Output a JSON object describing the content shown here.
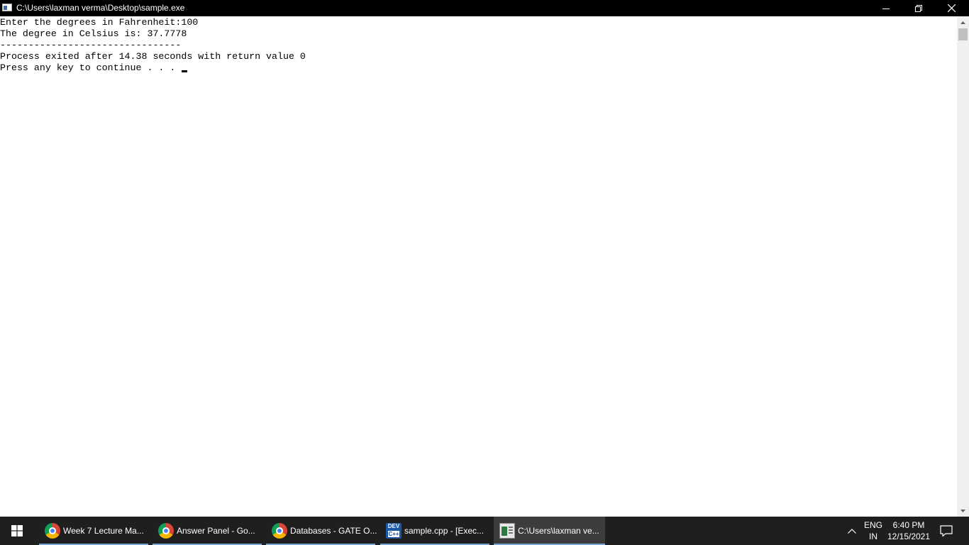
{
  "window": {
    "title": "C:\\Users\\laxman verma\\Desktop\\sample.exe",
    "controls": [
      "minimize-icon",
      "restore-icon",
      "close-icon"
    ]
  },
  "console": {
    "lines": [
      "Enter the degrees in Fahrenheit:100",
      "The degree in Celsius is: 37.7778",
      "--------------------------------",
      "Process exited after 14.38 seconds with return value 0",
      "Press any key to continue . . . "
    ]
  },
  "taskbar": {
    "items": [
      {
        "label": "Week 7 Lecture Ma...",
        "icon": "chrome-icon"
      },
      {
        "label": "Answer Panel - Go...",
        "icon": "chrome-icon"
      },
      {
        "label": "Databases - GATE O...",
        "icon": "chrome-icon"
      },
      {
        "label": "sample.cpp - [Exec...",
        "icon": "devcpp-icon",
        "icon_text_top": "DEV",
        "icon_text_bottom": "C++"
      },
      {
        "label": "C:\\Users\\laxman ve...",
        "icon": "console-app-icon",
        "active": true
      }
    ],
    "tray": {
      "lang_top": "ENG",
      "lang_bottom": "IN",
      "time": "6:40 PM",
      "date": "12/15/2021"
    }
  },
  "colors": {
    "titlebar_bg": "#000000",
    "taskbar_bg": "#1f1f1f",
    "active_task_bg": "#3c3c3c",
    "task_underline": "#7aa7d6",
    "console_bg": "#ffffff"
  }
}
